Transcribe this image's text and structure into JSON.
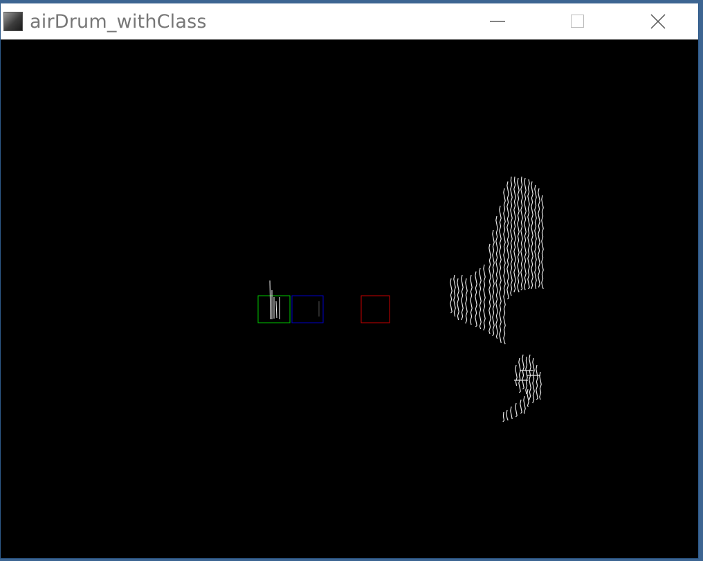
{
  "window": {
    "title": "airDrum_withClass",
    "icon": "app-icon",
    "controls": [
      "minimize-icon",
      "maximize-icon",
      "close-icon"
    ]
  },
  "scene": {
    "background_color": "#000000",
    "point_color": "#ffffff",
    "drum_zone_colors": {
      "left": "#00c800",
      "middle": "#0000c8",
      "right": "#c80000"
    }
  }
}
